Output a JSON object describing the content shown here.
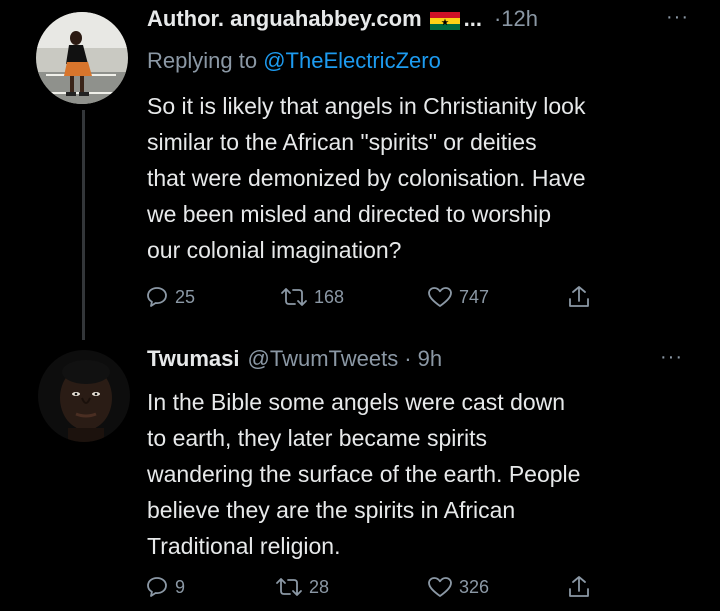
{
  "tweets": [
    {
      "author_name": "Author. anguahabbey.com",
      "name_suffix": "...",
      "time": "·12h",
      "more": "···",
      "replying_prefix": "Replying to",
      "replying_mention": "@TheElectricZero",
      "text_lines": [
        "So it is likely that angels in Christianity look",
        "similar to the African \"spirits\" or deities",
        "that were demonized by colonisation. Have",
        "we been misled and directed to worship",
        "our colonial imagination?"
      ],
      "replies": "25",
      "retweets": "168",
      "likes": "747",
      "icons": [
        "reply-icon",
        "retweet-icon",
        "like-icon",
        "share-icon"
      ]
    },
    {
      "author_name": "Twumasi",
      "handle": "@TwumTweets",
      "time": "· 9h",
      "more": "···",
      "text_lines": [
        "In the Bible some angels were cast down",
        "to earth, they later became spirits",
        "wandering the surface of the earth. People",
        "believe they are the spirits in African",
        "Traditional religion."
      ],
      "replies": "9",
      "retweets": "28",
      "likes": "326",
      "icons": [
        "reply-icon",
        "retweet-icon",
        "like-icon",
        "share-icon"
      ]
    }
  ],
  "colors": {
    "background": "#000000",
    "text": "#e7e9ea",
    "muted": "#8b98a5",
    "link": "#1d9bf0",
    "thread_line": "#333639"
  }
}
